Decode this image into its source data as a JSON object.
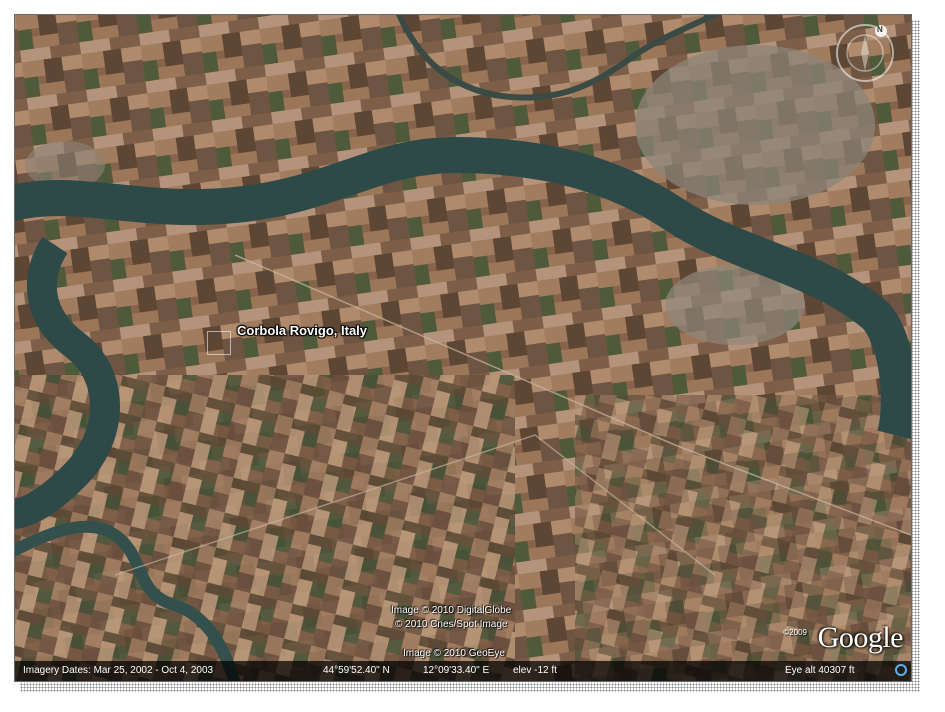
{
  "place_label": "Corbola Rovigo, Italy",
  "credits": {
    "line1": "Image © 2010 DigitalGlobe",
    "line2": "© 2010 Cnes/Spot Image",
    "line3": "Image © 2010 GeoEye"
  },
  "logo": {
    "year": "©2009",
    "text": "Google"
  },
  "status_bar": {
    "imagery_dates": "Imagery Dates: Mar 25, 2002 - Oct 4, 2003",
    "latitude": "44°59'52.40\" N",
    "longitude": "12°09'33.40\" E",
    "elevation": "elev  -12 ft",
    "eye_alt": "Eye alt   40307 ft"
  },
  "compass": {
    "north_label": "N"
  },
  "icons": [
    "compass-icon",
    "status-circle-icon"
  ],
  "colors": {
    "river": "#2d4a48",
    "fields_base": "#7a5a40",
    "status_icon": "#5ab0e8"
  }
}
